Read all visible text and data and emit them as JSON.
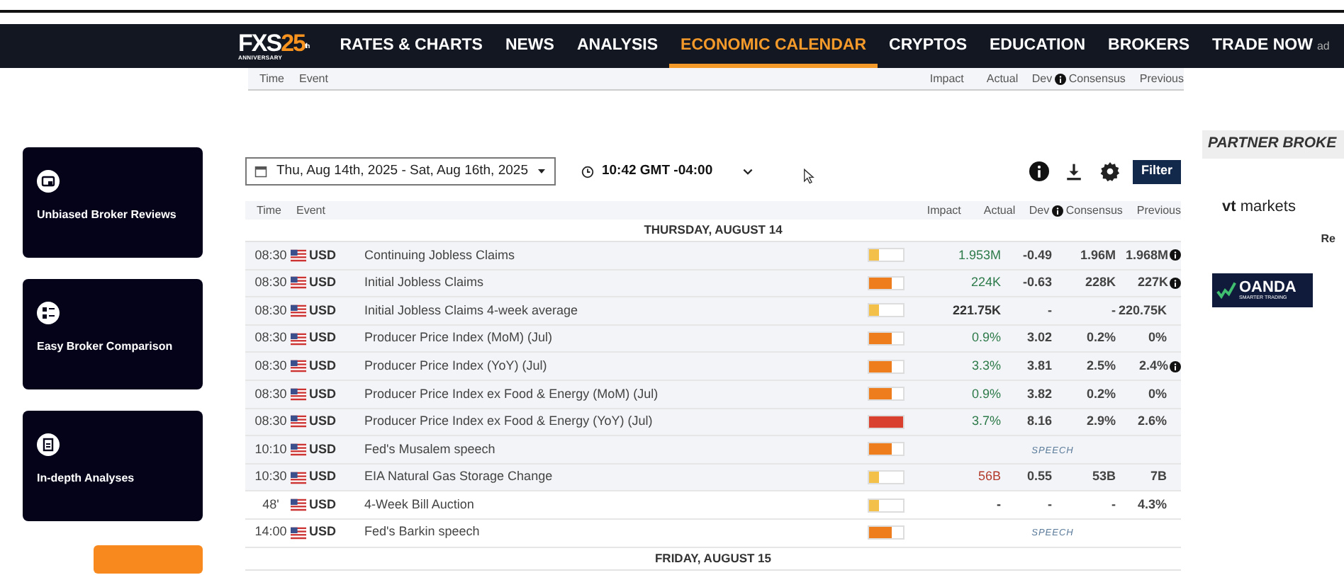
{
  "nav": {
    "logo": {
      "mark": "FXS",
      "number": "25",
      "suffix": "th",
      "caption": "ANNIVERSARY"
    },
    "items": [
      {
        "label": "RATES & CHARTS",
        "selected": false
      },
      {
        "label": "NEWS",
        "selected": false
      },
      {
        "label": "ANALYSIS",
        "selected": false
      },
      {
        "label": "ECONOMIC CALENDAR",
        "selected": true
      },
      {
        "label": "CRYPTOS",
        "selected": false
      },
      {
        "label": "EDUCATION",
        "selected": false
      },
      {
        "label": "BROKERS",
        "selected": false
      },
      {
        "label": "TRADE NOW",
        "selected": false,
        "tag": "ad"
      }
    ]
  },
  "sticky_header": [
    "Time",
    "Event",
    "Impact",
    "Actual",
    "Dev",
    "Consensus",
    "Previous"
  ],
  "sidebar_cards": [
    {
      "label": "Unbiased Broker Reviews",
      "kind": "reviews"
    },
    {
      "label": "Easy Broker Comparison",
      "kind": "comparison"
    },
    {
      "label": "In-depth Analyses",
      "kind": "analyses"
    }
  ],
  "toolbar": {
    "date_range": "Thu, Aug 14th, 2025 -  Sat, Aug 16th, 2025",
    "time": "10:42 GMT -04:00",
    "filter": "Filter"
  },
  "table": {
    "columns": [
      "Time",
      "Event",
      "Impact",
      "Actual",
      "Dev",
      "Consensus",
      "Previous"
    ],
    "days": [
      {
        "label": "THURSDAY, AUGUST 14",
        "rows": [
          {
            "time": "08:30",
            "currency": "USD",
            "event": "Continuing Jobless Claims",
            "impact": {
              "level": 0.3,
              "color": "#f3c04a"
            },
            "actual": {
              "text": "1.953M",
              "color": "#2d7a4a"
            },
            "dev": "-0.49",
            "consensus": "1.96M",
            "previous": "1.968M",
            "revised": true,
            "past": true
          },
          {
            "time": "08:30",
            "currency": "USD",
            "event": "Initial Jobless Claims",
            "impact": {
              "level": 0.65,
              "color": "#ee7d1d"
            },
            "actual": {
              "text": "224K",
              "color": "#2d7a4a"
            },
            "dev": "-0.63",
            "consensus": "228K",
            "previous": "227K",
            "revised": true,
            "past": true
          },
          {
            "time": "08:30",
            "currency": "USD",
            "event": "Initial Jobless Claims 4-week average",
            "impact": {
              "level": 0.3,
              "color": "#f3c04a"
            },
            "actual": {
              "text": "221.75K",
              "color": "#333333"
            },
            "dev": "-",
            "consensus": "-",
            "previous": "220.75K",
            "revised": false,
            "past": true
          },
          {
            "time": "08:30",
            "currency": "USD",
            "event": "Producer Price Index (MoM) (Jul)",
            "impact": {
              "level": 0.65,
              "color": "#ee7d1d"
            },
            "actual": {
              "text": "0.9%",
              "color": "#2d7a4a"
            },
            "dev": "3.02",
            "consensus": "0.2%",
            "previous": "0%",
            "revised": false,
            "past": true
          },
          {
            "time": "08:30",
            "currency": "USD",
            "event": "Producer Price Index (YoY) (Jul)",
            "impact": {
              "level": 0.65,
              "color": "#ee7d1d"
            },
            "actual": {
              "text": "3.3%",
              "color": "#2d7a4a"
            },
            "dev": "3.81",
            "consensus": "2.5%",
            "previous": "2.4%",
            "revised": true,
            "past": true
          },
          {
            "time": "08:30",
            "currency": "USD",
            "event": "Producer Price Index ex Food & Energy (MoM) (Jul)",
            "impact": {
              "level": 0.65,
              "color": "#ee7d1d"
            },
            "actual": {
              "text": "0.9%",
              "color": "#2d7a4a"
            },
            "dev": "3.82",
            "consensus": "0.2%",
            "previous": "0%",
            "revised": false,
            "past": true
          },
          {
            "time": "08:30",
            "currency": "USD",
            "event": "Producer Price Index ex Food & Energy (YoY) (Jul)",
            "impact": {
              "level": 1,
              "color": "#d9402e"
            },
            "actual": {
              "text": "3.7%",
              "color": "#2d7a4a"
            },
            "dev": "8.16",
            "consensus": "2.9%",
            "previous": "2.6%",
            "revised": false,
            "past": true
          },
          {
            "time": "10:10",
            "currency": "USD",
            "event": "Fed's Musalem speech",
            "impact": {
              "level": 0.65,
              "color": "#ee7d1d"
            },
            "kind": "speech",
            "note": "SPEECH",
            "past": true
          },
          {
            "time": "10:30",
            "currency": "USD",
            "event": "EIA Natural Gas Storage Change",
            "impact": {
              "level": 0.3,
              "color": "#f3c04a"
            },
            "actual": {
              "text": "56B",
              "color": "#b23b2b"
            },
            "dev": "0.55",
            "consensus": "53B",
            "previous": "7B",
            "revised": false,
            "past": true
          },
          {
            "time": "48'",
            "currency": "USD",
            "event": "4-Week Bill Auction",
            "impact": {
              "level": 0.3,
              "color": "#f3c04a"
            },
            "actual": {
              "text": "-",
              "color": "#333333"
            },
            "dev": "-",
            "consensus": "-",
            "previous": "4.3%",
            "revised": false,
            "past": false
          },
          {
            "time": "14:00",
            "currency": "USD",
            "event": "Fed's Barkin speech",
            "impact": {
              "level": 0.65,
              "color": "#ee7d1d"
            },
            "kind": "speech",
            "note": "SPEECH",
            "past": false
          }
        ]
      },
      {
        "label": "FRIDAY, AUGUST 15"
      }
    ]
  },
  "partners": {
    "title": "PARTNER BROKE",
    "brokers": [
      {
        "kind": "vt",
        "name": "markets",
        "mark": "vt"
      },
      {
        "kind": "cut",
        "name": "Re"
      },
      {
        "kind": "oanda",
        "name": "OANDA",
        "tagline": "SMARTER TRADING"
      }
    ]
  }
}
